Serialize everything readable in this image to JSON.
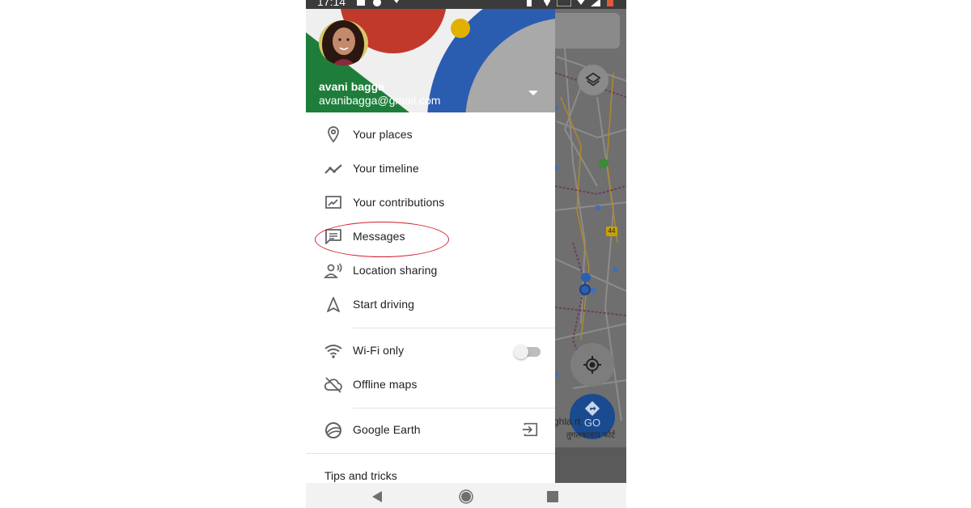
{
  "status_bar": {
    "time": "17:14"
  },
  "account": {
    "name": "avani bagga",
    "email": "avanibagga@gmail.com"
  },
  "menu": {
    "group1": [
      {
        "label": "Your places",
        "icon": "pin-icon"
      },
      {
        "label": "Your timeline",
        "icon": "timeline-icon"
      },
      {
        "label": "Your contributions",
        "icon": "contributions-icon"
      },
      {
        "label": "Messages",
        "icon": "message-icon"
      },
      {
        "label": "Location sharing",
        "icon": "location-sharing-icon"
      },
      {
        "label": "Start driving",
        "icon": "navigation-arrow-icon"
      }
    ],
    "group2": [
      {
        "label": "Wi-Fi only",
        "icon": "wifi-icon"
      },
      {
        "label": "Offline maps",
        "icon": "offline-maps-icon"
      }
    ],
    "group3": [
      {
        "label": "Google Earth",
        "icon": "google-earth-icon"
      }
    ],
    "tips": "Tips and tricks",
    "wifi_only_enabled": false
  },
  "map": {
    "go_label": "GO",
    "road_number": "44",
    "place_label": "ghla   rt",
    "place_sublabel": "तुगलकाबाद फोर्ट"
  },
  "colors": {
    "header_green": "#1e7d3a",
    "header_red": "#c0392b",
    "header_blue": "#2a5db0",
    "header_yellow": "#e2b100",
    "annotation_red": "#d21e2b",
    "go_button": "#1a4a8f"
  }
}
